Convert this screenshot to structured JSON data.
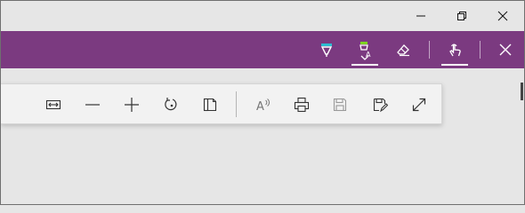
{
  "window": {
    "controls": [
      {
        "name": "minimize-icon"
      },
      {
        "name": "restore-icon"
      },
      {
        "name": "close-icon"
      }
    ]
  },
  "ink_toolbar": {
    "accent": "#7b3a80",
    "tools": [
      {
        "name": "ballpoint-pen-icon",
        "color": "#2bbbd0"
      },
      {
        "name": "highlighter-icon",
        "color": "#7ed321",
        "selected": true
      },
      {
        "name": "eraser-icon"
      },
      {
        "name": "touch-writing-icon",
        "selected": true
      },
      {
        "name": "close-icon"
      }
    ]
  },
  "pdf_toolbar": {
    "tools": [
      {
        "name": "fit-to-width-icon"
      },
      {
        "name": "zoom-out-icon"
      },
      {
        "name": "zoom-in-icon"
      },
      {
        "name": "rotate-icon"
      },
      {
        "name": "page-view-icon"
      },
      {
        "name": "read-aloud-icon"
      },
      {
        "name": "print-icon"
      },
      {
        "name": "save-icon"
      },
      {
        "name": "save-as-icon"
      },
      {
        "name": "full-screen-icon"
      }
    ]
  }
}
